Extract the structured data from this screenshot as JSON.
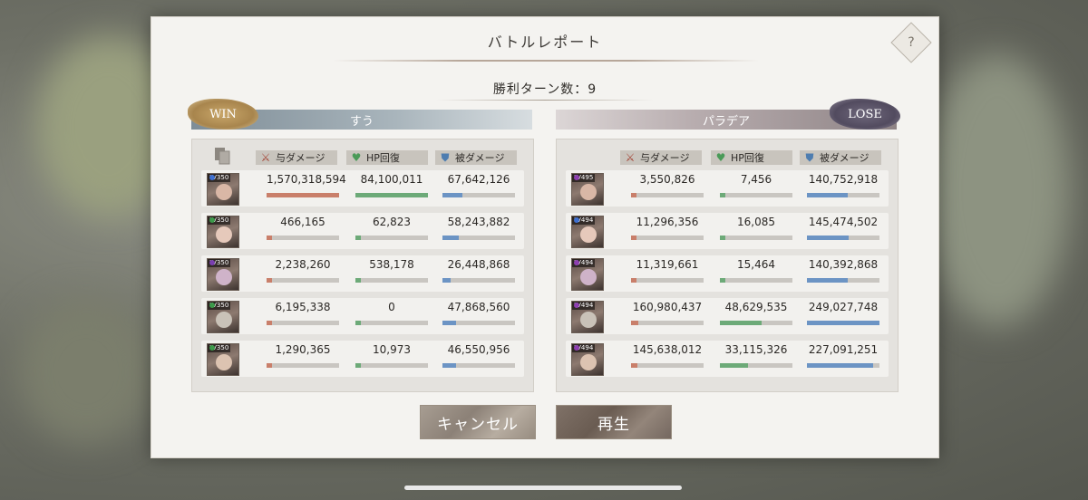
{
  "dialog": {
    "title": "バトルレポート",
    "turns_label": "勝利ターン数：9",
    "help_icon": "?"
  },
  "teams": {
    "left": {
      "badge": "WIN",
      "name": "すう"
    },
    "right": {
      "badge": "LOSE",
      "name": "パラデア"
    }
  },
  "columns": {
    "damage": "与ダメージ",
    "heal": "HP回復",
    "taken": "被ダメージ"
  },
  "left_rows": [
    {
      "level": "LV350",
      "damage": "1,570,318,594",
      "heal": "84,100,011",
      "taken": "67,642,126",
      "damage_pct": 1.0,
      "heal_pct": 1.0,
      "taken_pct": 0.27
    },
    {
      "level": "LV350",
      "damage": "466,165",
      "heal": "62,823",
      "taken": "58,243,882",
      "damage_pct": 0.0,
      "heal_pct": 0.0,
      "taken_pct": 0.23
    },
    {
      "level": "LV350",
      "damage": "2,238,260",
      "heal": "538,178",
      "taken": "26,448,868",
      "damage_pct": 0.0,
      "heal_pct": 0.0,
      "taken_pct": 0.11
    },
    {
      "level": "LV350",
      "damage": "6,195,338",
      "heal": "0",
      "taken": "47,868,560",
      "damage_pct": 0.0,
      "heal_pct": 0.0,
      "taken_pct": 0.19
    },
    {
      "level": "LV350",
      "damage": "1,290,365",
      "heal": "10,973",
      "taken": "46,550,956",
      "damage_pct": 0.0,
      "heal_pct": 0.0,
      "taken_pct": 0.19
    }
  ],
  "right_rows": [
    {
      "level": "LV495",
      "damage": "3,550,826",
      "heal": "7,456",
      "taken": "140,752,918",
      "damage_pct": 0.0,
      "heal_pct": 0.0,
      "taken_pct": 0.56
    },
    {
      "level": "LV494",
      "damage": "11,296,356",
      "heal": "16,085",
      "taken": "145,474,502",
      "damage_pct": 0.0,
      "heal_pct": 0.0,
      "taken_pct": 0.58
    },
    {
      "level": "LV494",
      "damage": "11,319,661",
      "heal": "15,464",
      "taken": "140,392,868",
      "damage_pct": 0.0,
      "heal_pct": 0.0,
      "taken_pct": 0.56
    },
    {
      "level": "LV494",
      "damage": "160,980,437",
      "heal": "48,629,535",
      "taken": "249,027,748",
      "damage_pct": 0.1,
      "heal_pct": 0.58,
      "taken_pct": 1.0
    },
    {
      "level": "LV494",
      "damage": "145,638,012",
      "heal": "33,115,326",
      "taken": "227,091,251",
      "damage_pct": 0.09,
      "heal_pct": 0.39,
      "taken_pct": 0.91
    }
  ],
  "buttons": {
    "cancel": "キャンセル",
    "play": "再生"
  },
  "colors": {
    "damage_bar": "#c97f6a",
    "heal_bar": "#6daa78",
    "taken_bar": "#6c94c4",
    "left_gems": [
      "#3e6fd0",
      "#3c9a4a",
      "#7a3fb0",
      "#3c9a4a",
      "#3c9a4a"
    ],
    "right_gems": [
      "#8d3fb0",
      "#3e6fd0",
      "#8d3fb0",
      "#8d3fb0",
      "#8d3fb0"
    ]
  }
}
